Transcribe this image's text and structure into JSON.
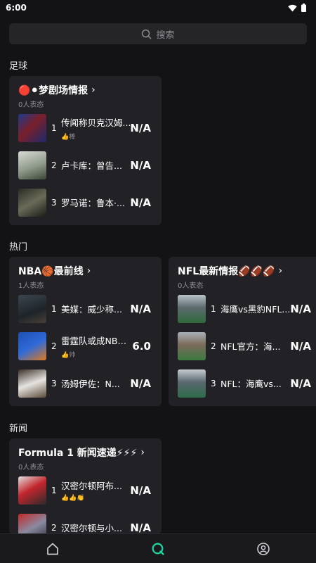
{
  "status_bar": {
    "time": "6:00"
  },
  "search": {
    "placeholder": "搜索"
  },
  "sections": [
    {
      "title": "足球"
    },
    {
      "title": "热门"
    },
    {
      "title": "新闻"
    }
  ],
  "cards": [
    {
      "title": "🔴⚫梦剧场情报",
      "subtitle": "0人表态",
      "items": [
        {
          "rank": "1",
          "title": "传闻称贝克汉姆...",
          "sub": "👍棒",
          "score": "N/A"
        },
        {
          "rank": "2",
          "title": "卢卡库：曾告...",
          "sub": "",
          "score": "N/A"
        },
        {
          "rank": "3",
          "title": "罗马诺：鲁本·...",
          "sub": "",
          "score": "N/A"
        }
      ]
    },
    {
      "title": "NBA🏀最前线",
      "subtitle": "1人表态",
      "items": [
        {
          "rank": "1",
          "title": "美媒：威少称...",
          "sub": "",
          "score": "N/A"
        },
        {
          "rank": "2",
          "title": "雷霆队或成NBA...",
          "sub": "👍帅",
          "score": "6.0"
        },
        {
          "rank": "3",
          "title": "汤姆伊佐：N...",
          "sub": "",
          "score": "N/A"
        }
      ]
    },
    {
      "title": "NFL最新情报🏈🏈🏈",
      "subtitle": "0人表态",
      "items": [
        {
          "rank": "1",
          "title": "海鹰vs黑豹NFL...",
          "sub": "",
          "score": "N/A"
        },
        {
          "rank": "2",
          "title": "NFL官方：海...",
          "sub": "",
          "score": "N/A"
        },
        {
          "rank": "3",
          "title": "NFL：海鹰vs...",
          "sub": "",
          "score": "N/A"
        }
      ]
    },
    {
      "title": "Formula 1 新闻速递⚡⚡⚡",
      "subtitle": "0人表态",
      "items": [
        {
          "rank": "1",
          "title": "汉密尔顿阿布...",
          "sub": "👍👍👏",
          "score": "N/A"
        },
        {
          "rank": "2",
          "title": "汉密尔顿与小...",
          "sub": "",
          "score": "N/A"
        }
      ]
    }
  ],
  "colors": {
    "background": "#131316",
    "card": "#222226",
    "accent": "#1ed3a0",
    "muted": "#8e8e93"
  },
  "nav": [
    "home-icon",
    "discover-icon",
    "profile-icon"
  ]
}
